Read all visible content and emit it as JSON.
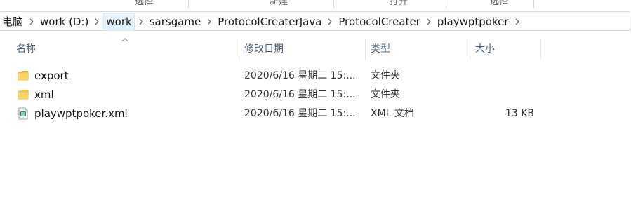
{
  "ribbon": {
    "hints": [
      "选择",
      "新建",
      "打开",
      "选择"
    ]
  },
  "address": {
    "crumbs": [
      {
        "label": "电脑",
        "active": false
      },
      {
        "label": "work (D:)",
        "active": false
      },
      {
        "label": "work",
        "active": true
      },
      {
        "label": "sarsgame",
        "active": false
      },
      {
        "label": "ProtocolCreaterJava",
        "active": false
      },
      {
        "label": "ProtocolCreater",
        "active": false
      },
      {
        "label": "playwptpoker",
        "active": false
      }
    ]
  },
  "columns": {
    "name": "名称",
    "date": "修改日期",
    "type": "类型",
    "size": "大小"
  },
  "files": [
    {
      "name": "export",
      "date": "2020/6/16 星期二 15:...",
      "type": "文件夹",
      "size": "",
      "icon": "folder-icon"
    },
    {
      "name": "xml",
      "date": "2020/6/16 星期二 15:...",
      "type": "文件夹",
      "size": "",
      "icon": "folder-icon"
    },
    {
      "name": "playwptpoker.xml",
      "date": "2020/6/16 星期二 15:...",
      "type": "XML 文档",
      "size": "13 KB",
      "icon": "xml-file-icon"
    }
  ],
  "colors": {
    "folder": "#e8b43c",
    "header_text": "#4c607a",
    "active_crumb_bg": "#e5f3ff"
  }
}
